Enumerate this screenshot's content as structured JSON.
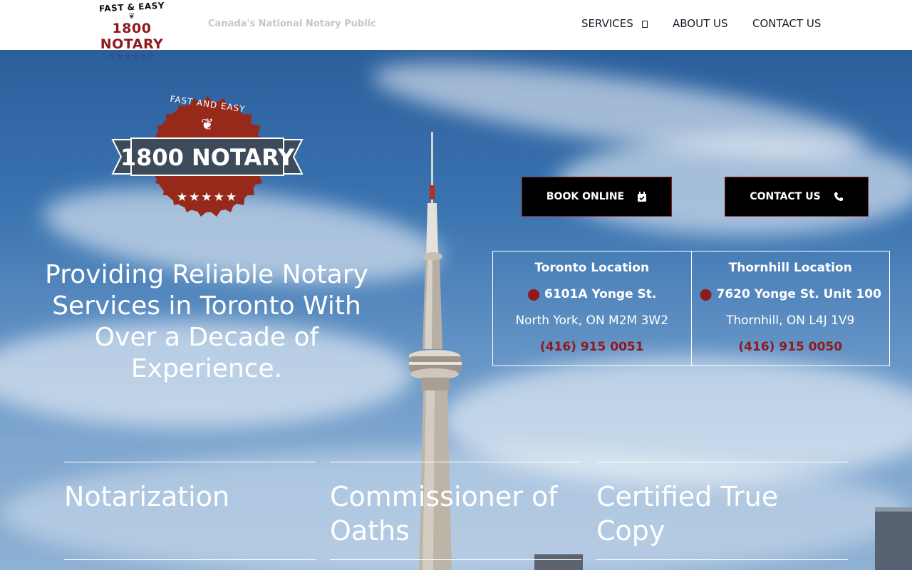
{
  "header": {
    "logo": {
      "top_text": "FAST & EASY",
      "brand": "1800 NOTARY",
      "stars": "☆☆☆☆☆☆"
    },
    "tagline": "Canada's National Notary Public",
    "nav": {
      "services": "SERVICES",
      "about": "ABOUT US",
      "contact": "CONTACT US"
    }
  },
  "hero": {
    "badge": {
      "arc_text": "FAST AND EASY",
      "brand": "1800 NOTARY",
      "stars": "★★★★★"
    },
    "headline": "Providing Reliable Notary Services in Toronto With Over a Decade of Experience.",
    "buttons": {
      "book": "BOOK ONLINE",
      "contact": "CONTACT US"
    },
    "locations": [
      {
        "name": "Toronto Location",
        "address": "6101A Yonge St.",
        "city": "North York, ON M2M 3W2",
        "phone": "(416) 915 0051"
      },
      {
        "name": "Thornhill Location",
        "address": "7620 Yonge St. Unit 100",
        "city": "Thornhill, ON L4J 1V9",
        "phone": "(416) 915 0050"
      }
    ],
    "services": [
      {
        "label": "Notarization"
      },
      {
        "label_line1": "Commissioner of",
        "label_line2": "Oaths"
      },
      {
        "label": "Certified True Copy"
      }
    ]
  },
  "colors": {
    "brand_red": "#8e1a1e",
    "badge_red": "#96291a",
    "button_bg": "#000000",
    "sky": "#3a73b0"
  },
  "icons": {
    "services_caret": "dropdown-square-icon",
    "book": "calendar-check-icon",
    "contact": "phone-icon",
    "location": "map-pin-icon"
  }
}
